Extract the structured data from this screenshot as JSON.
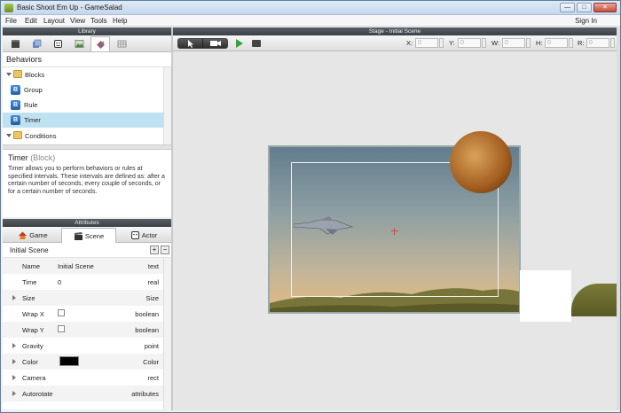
{
  "window": {
    "title": "Basic Shoot Em Up - GameSalad",
    "min": "—",
    "max": "□",
    "close": "✕"
  },
  "menu": {
    "items": [
      "File",
      "Edit",
      "Layout",
      "View",
      "Tools",
      "Help"
    ],
    "sign_in": "Sign In"
  },
  "library": {
    "header": "Library",
    "tabs": [
      "scenes-icon",
      "layers-icon",
      "actors-icon",
      "images-icon",
      "behaviors-icon",
      "tables-icon"
    ],
    "section_title": "Behaviors",
    "rows": [
      {
        "label": "Blocks",
        "kind": "folder"
      },
      {
        "label": "Group",
        "kind": "block"
      },
      {
        "label": "Rule",
        "kind": "block"
      },
      {
        "label": "Timer",
        "kind": "block",
        "selected": true
      },
      {
        "label": "Conditions",
        "kind": "folder"
      }
    ],
    "block_badge": "B"
  },
  "description": {
    "title": "Timer",
    "type": "(Block)",
    "body": "Timer allows you to perform behaviors or rules at specified intervals. These intervals are defined as: after a certain number of seconds, every couple of seconds, or for a certain number of seconds."
  },
  "attributes": {
    "header": "Attributes",
    "tabs": [
      "Game",
      "Scene",
      "Actor"
    ],
    "scene_name": "Initial Scene",
    "add_label": "+",
    "remove_label": "−",
    "rows": [
      {
        "name": "Name",
        "value": "Initial Scene",
        "type": "text"
      },
      {
        "name": "Time",
        "value": "0",
        "type": "real"
      },
      {
        "name": "Size",
        "value": "",
        "type": "Size"
      },
      {
        "name": "Wrap X",
        "value": "",
        "type": "boolean"
      },
      {
        "name": "Wrap Y",
        "value": "",
        "type": "boolean"
      },
      {
        "name": "Gravity",
        "value": "",
        "type": "point"
      },
      {
        "name": "Color",
        "value": "",
        "type": "Color"
      },
      {
        "name": "Camera",
        "value": "",
        "type": "rect"
      },
      {
        "name": "Autorotate",
        "value": "",
        "type": "attributes"
      }
    ],
    "color_swatch": "#000000"
  },
  "stage": {
    "header": "Stage - Initial Scene",
    "coords": {
      "x": "X:",
      "y": "Y:",
      "w": "W:",
      "h": "H:",
      "r": "R:",
      "placeholder": "0"
    }
  },
  "colors": {
    "header_dark": "#3b4046",
    "selection": "#bfe2f2",
    "play_green": "#2ea53a"
  }
}
